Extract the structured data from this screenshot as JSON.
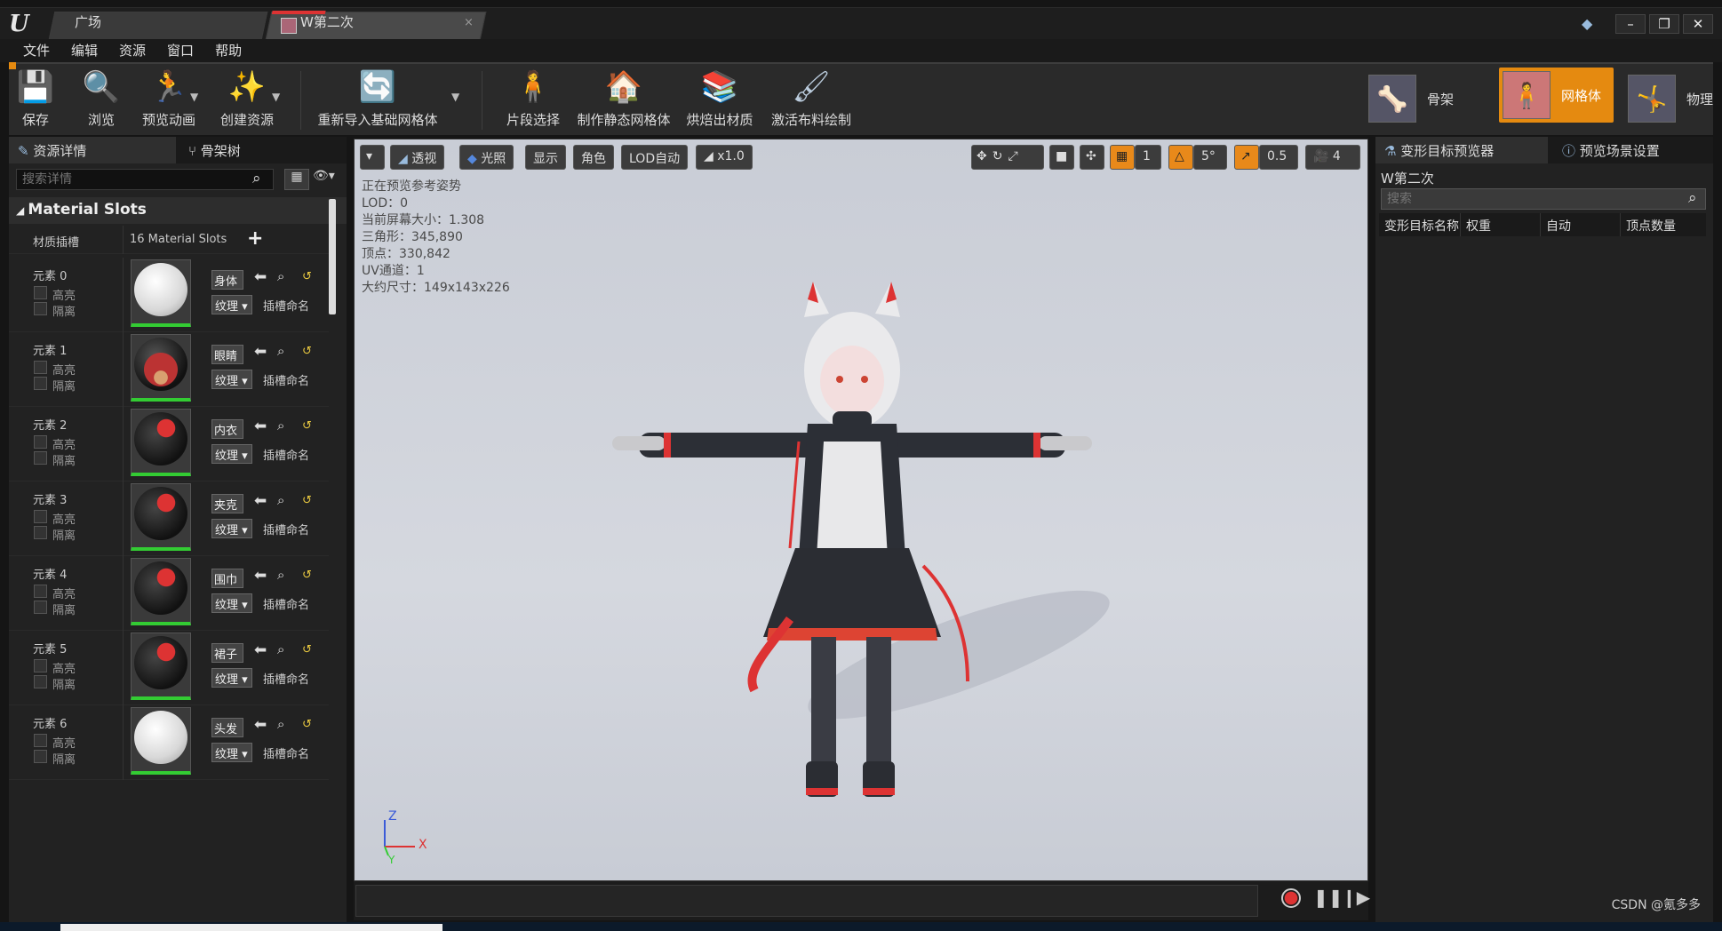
{
  "titlebar": {
    "tabs": [
      {
        "label": "广场"
      },
      {
        "label": "W第二次"
      }
    ],
    "close_glyph": "×",
    "window_controls": [
      "–",
      "❐",
      "✕"
    ]
  },
  "menu": [
    "文件",
    "编辑",
    "资源",
    "窗口",
    "帮助"
  ],
  "toolbar": {
    "buttons": [
      {
        "label": "保存",
        "icon": "save-icon"
      },
      {
        "label": "浏览",
        "icon": "browse-icon"
      },
      {
        "label": "预览动画",
        "icon": "preview-animation-icon"
      },
      {
        "label": "创建资源",
        "icon": "create-asset-icon"
      },
      {
        "label": "重新导入基础网格体",
        "icon": "reimport-icon"
      },
      {
        "label": "片段选择",
        "icon": "section-select-icon"
      },
      {
        "label": "制作静态网格体",
        "icon": "make-static-mesh-icon"
      },
      {
        "label": "烘焙出材质",
        "icon": "bake-material-icon"
      },
      {
        "label": "激活布料绘制",
        "icon": "cloth-paint-icon"
      }
    ],
    "modes": [
      {
        "label": "骨架",
        "icon": "skeleton-mode-icon"
      },
      {
        "label": "网格体",
        "icon": "mesh-mode-icon",
        "active": true
      },
      {
        "label": "物理",
        "icon": "physics-mode-icon"
      }
    ],
    "active_color": "#e58a10"
  },
  "left_panel": {
    "tabs": [
      {
        "label": "资源详情"
      },
      {
        "label": "骨架树"
      }
    ],
    "search_placeholder": "搜索详情",
    "section_title": "Material Slots",
    "slots_label": "材质插槽",
    "slots_count": "16 Material Slots",
    "add_glyph": "+",
    "highlight_label": "高亮",
    "isolate_label": "隔离",
    "texture_label": "纹理",
    "slot_name_label": "插槽命名",
    "elements": [
      {
        "name": "元素 0",
        "material": "身体",
        "ball": "white"
      },
      {
        "name": "元素 1",
        "material": "眼睛",
        "ball": "eye"
      },
      {
        "name": "元素 2",
        "material": "内衣",
        "ball": "dark"
      },
      {
        "name": "元素 3",
        "material": "夹克",
        "ball": "dark"
      },
      {
        "name": "元素 4",
        "material": "围巾",
        "ball": "dark"
      },
      {
        "name": "元素 5",
        "material": "裙子",
        "ball": "dark"
      },
      {
        "name": "元素 6",
        "material": "头发",
        "ball": "white"
      }
    ]
  },
  "viewport": {
    "toolbar": {
      "perspective": "透视",
      "lit": "光照",
      "show": "显示",
      "character": "角色",
      "lod": "LOD自动",
      "speed": "x1.0",
      "grid_snap": "1",
      "rot_snap": "5°",
      "scale_snap": "0.5",
      "cam_speed": "4"
    },
    "stats": [
      "正在预览参考姿势",
      "LOD：0",
      "当前屏幕大小：1.308",
      "三角形：345,890",
      "顶点：330,842",
      "UV通道：1",
      "大约尺寸：149x143x226"
    ],
    "axes": {
      "z": "Z",
      "x": "X",
      "y": "Y"
    }
  },
  "right_panel": {
    "tabs": [
      {
        "label": "变形目标预览器"
      },
      {
        "label": "预览场景设置"
      }
    ],
    "asset_name": "W第二次",
    "search_placeholder": "搜索",
    "columns": [
      "变形目标名称",
      "权重",
      "自动",
      "顶点数量"
    ]
  },
  "watermark": "CSDN @氪多多"
}
